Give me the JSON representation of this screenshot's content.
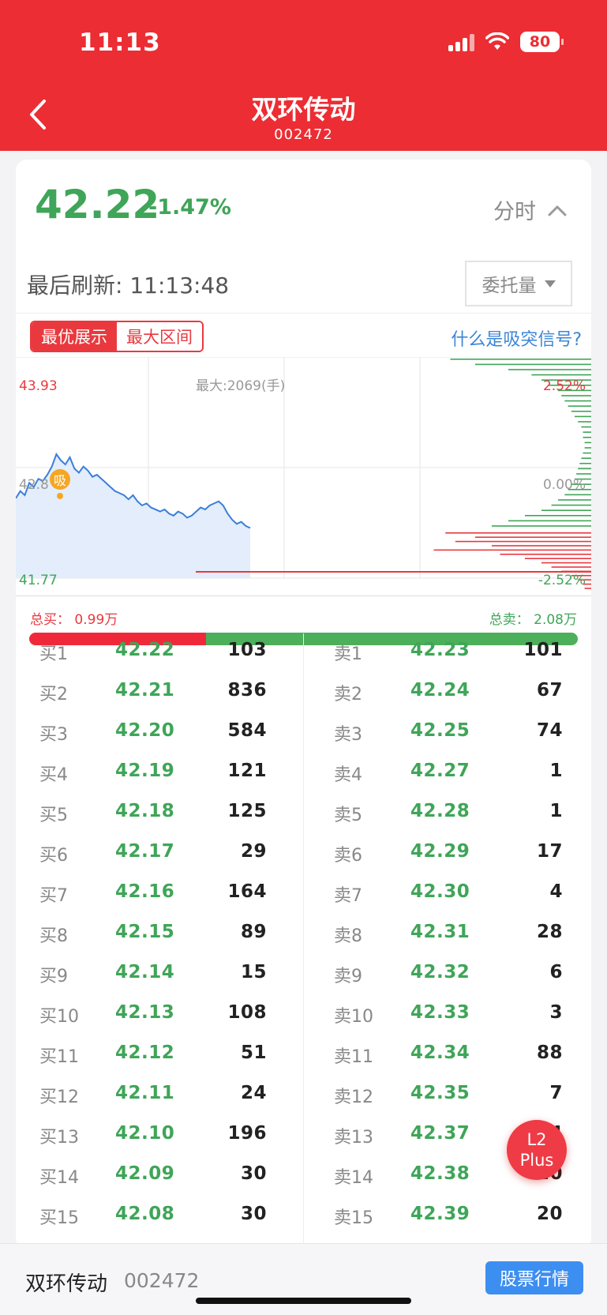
{
  "status": {
    "time": "11:13",
    "battery": "80"
  },
  "header": {
    "title": "双环传动",
    "code": "002472"
  },
  "quote": {
    "price": "42.22",
    "change": "-1.47%",
    "timeshare_label": "分时"
  },
  "refresh": {
    "label": "最后刷新: 11:13:48",
    "entrust_label": "委托量"
  },
  "tabs": {
    "best": "最优展示",
    "range": "最大区间",
    "help_link": "什么是吸突信号?"
  },
  "chart_data": {
    "type": "line",
    "price_high": "43.93",
    "price_mid": "42.8",
    "price_low": "41.77",
    "max_label": "最大:2069(手)",
    "pct_high": "2.52%",
    "pct_mid": "0.00%",
    "pct_low": "-2.52%",
    "signal_label": "吸",
    "price_line": [
      42.55,
      42.62,
      42.58,
      42.7,
      42.66,
      42.74,
      42.72,
      42.78,
      42.86,
      42.98,
      42.92,
      42.88,
      42.95,
      42.84,
      42.8,
      42.86,
      42.82,
      42.76,
      42.78,
      42.74,
      42.7,
      42.66,
      42.62,
      42.6,
      42.58,
      42.54,
      42.58,
      42.52,
      42.48,
      42.5,
      42.46,
      42.44,
      42.42,
      42.44,
      42.4,
      42.38,
      42.42,
      42.4,
      42.36,
      42.38,
      42.42,
      42.46,
      42.44,
      42.48,
      42.5,
      42.52,
      42.48,
      42.4,
      42.34,
      42.3,
      42.32,
      42.28,
      42.26
    ],
    "buy_bars": [
      0.88,
      0.7,
      0.82,
      0.6,
      0.95,
      0.55,
      0.4,
      0.3,
      0.24,
      0.18,
      0.12,
      0.08,
      0.05,
      0.04
    ],
    "sell_bars": [
      0.85,
      0.7,
      0.5,
      0.36,
      0.3,
      0.26,
      0.2,
      0.18,
      0.16,
      0.14,
      0.12,
      0.1,
      0.08,
      0.06,
      0.05,
      0.05,
      0.04,
      0.04,
      0.05,
      0.06,
      0.07,
      0.08,
      0.09,
      0.1,
      0.12,
      0.14,
      0.16,
      0.2,
      0.24,
      0.3,
      0.4,
      0.5,
      0.6,
      0.7
    ]
  },
  "totals": {
    "buy": "总买： 0.99万",
    "sell": "总卖： 2.08万",
    "buy_ratio": 0.323
  },
  "order_book": {
    "bids": [
      {
        "label": "买1",
        "price": "42.22",
        "vol": "103"
      },
      {
        "label": "买2",
        "price": "42.21",
        "vol": "836"
      },
      {
        "label": "买3",
        "price": "42.20",
        "vol": "584"
      },
      {
        "label": "买4",
        "price": "42.19",
        "vol": "121"
      },
      {
        "label": "买5",
        "price": "42.18",
        "vol": "125"
      },
      {
        "label": "买6",
        "price": "42.17",
        "vol": "29"
      },
      {
        "label": "买7",
        "price": "42.16",
        "vol": "164"
      },
      {
        "label": "买8",
        "price": "42.15",
        "vol": "89"
      },
      {
        "label": "买9",
        "price": "42.14",
        "vol": "15"
      },
      {
        "label": "买10",
        "price": "42.13",
        "vol": "108"
      },
      {
        "label": "买11",
        "price": "42.12",
        "vol": "51"
      },
      {
        "label": "买12",
        "price": "42.11",
        "vol": "24"
      },
      {
        "label": "买13",
        "price": "42.10",
        "vol": "196"
      },
      {
        "label": "买14",
        "price": "42.09",
        "vol": "30"
      },
      {
        "label": "买15",
        "price": "42.08",
        "vol": "30"
      }
    ],
    "asks": [
      {
        "label": "卖1",
        "price": "42.23",
        "vol": "101"
      },
      {
        "label": "卖2",
        "price": "42.24",
        "vol": "67"
      },
      {
        "label": "卖3",
        "price": "42.25",
        "vol": "74"
      },
      {
        "label": "卖4",
        "price": "42.27",
        "vol": "1"
      },
      {
        "label": "卖5",
        "price": "42.28",
        "vol": "1"
      },
      {
        "label": "卖6",
        "price": "42.29",
        "vol": "17"
      },
      {
        "label": "卖7",
        "price": "42.30",
        "vol": "4"
      },
      {
        "label": "卖8",
        "price": "42.31",
        "vol": "28"
      },
      {
        "label": "卖9",
        "price": "42.32",
        "vol": "6"
      },
      {
        "label": "卖10",
        "price": "42.33",
        "vol": "3"
      },
      {
        "label": "卖11",
        "price": "42.34",
        "vol": "88"
      },
      {
        "label": "卖12",
        "price": "42.35",
        "vol": "7"
      },
      {
        "label": "卖13",
        "price": "42.37",
        "vol": "4"
      },
      {
        "label": "卖14",
        "price": "42.38",
        "vol": "20"
      },
      {
        "label": "卖15",
        "price": "42.39",
        "vol": "20"
      }
    ]
  },
  "float_button": {
    "line1": "L2",
    "line2": "Plus"
  },
  "bottom_bar": {
    "name": "双环传动",
    "code": "002472",
    "button": "股票行情"
  },
  "colors": {
    "brand_red": "#ec2d33",
    "up_green": "#3fa558",
    "link_blue": "#3c86d6",
    "button_blue": "#3d8ef1"
  }
}
